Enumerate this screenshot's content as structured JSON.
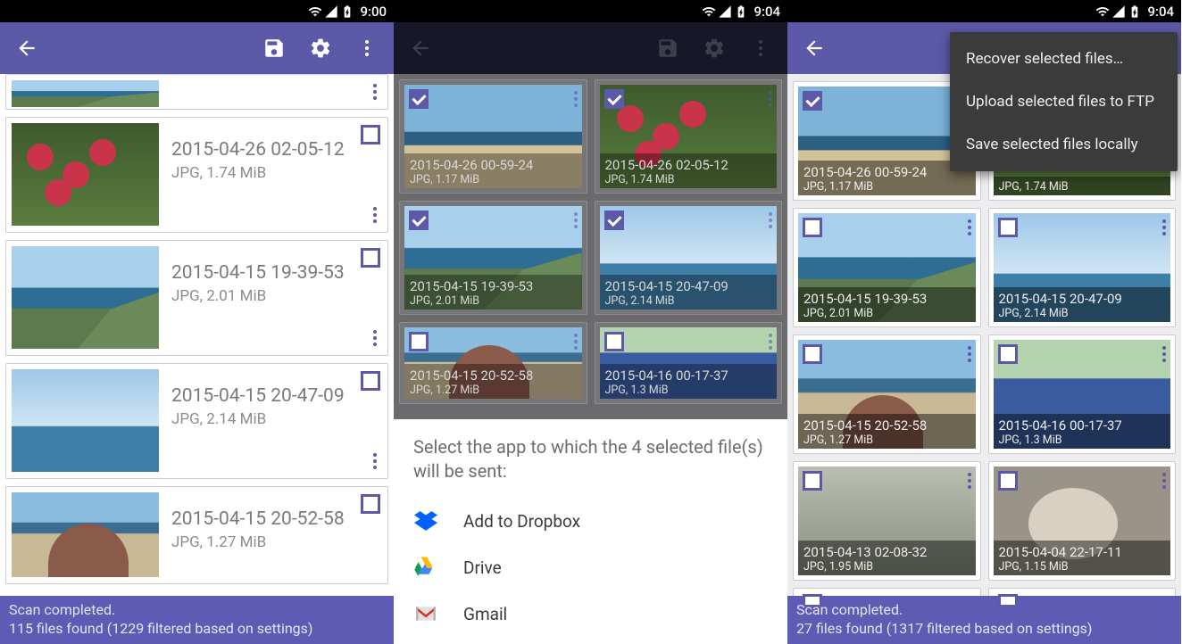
{
  "screen1": {
    "status_time": "9:00",
    "items": [
      {
        "title": "2015-04-26 02-05-12",
        "meta": "JPG, 1.74 MiB"
      },
      {
        "title": "2015-04-15 19-39-53",
        "meta": "JPG, 2.01 MiB"
      },
      {
        "title": "2015-04-15 20-47-09",
        "meta": "JPG, 2.14 MiB"
      },
      {
        "title": "2015-04-15 20-52-58",
        "meta": "JPG, 1.27 MiB"
      }
    ],
    "footer_line1": "Scan completed.",
    "footer_line2": "115 files found (1229 filtered based on settings)"
  },
  "screen2": {
    "status_time": "9:04",
    "items": [
      {
        "title": "2015-04-26 00-59-24",
        "meta": "JPG, 1.17 MiB",
        "checked": true
      },
      {
        "title": "2015-04-26 02-05-12",
        "meta": "JPG, 1.74 MiB",
        "checked": true
      },
      {
        "title": "2015-04-15 19-39-53",
        "meta": "JPG, 2.01 MiB",
        "checked": true
      },
      {
        "title": "2015-04-15 20-47-09",
        "meta": "JPG, 2.14 MiB",
        "checked": true
      },
      {
        "title": "2015-04-15 20-52-58",
        "meta": "JPG, 1.27 MiB",
        "checked": false
      },
      {
        "title": "2015-04-16 00-17-37",
        "meta": "JPG, 1.3 MiB",
        "checked": false
      }
    ],
    "sheet_title": "Select the app to which the 4 selected file(s) will be sent:",
    "apps": {
      "dropbox": "Add to Dropbox",
      "drive": "Drive",
      "gmail": "Gmail"
    }
  },
  "screen3": {
    "status_time": "9:04",
    "menu": {
      "recover": "Recover selected files…",
      "ftp": "Upload selected files to FTP",
      "local": "Save selected files locally"
    },
    "items": [
      {
        "title": "2015-04-26 00-59-24",
        "meta": "JPG, 1.17 MiB",
        "checked": true
      },
      {
        "title": "",
        "meta": "JPG, 1.74 MiB",
        "checked": false
      },
      {
        "title": "2015-04-15 19-39-53",
        "meta": "JPG, 2.01 MiB",
        "checked": false
      },
      {
        "title": "2015-04-15 20-47-09",
        "meta": "JPG, 2.14 MiB",
        "checked": false
      },
      {
        "title": "2015-04-15 20-52-58",
        "meta": "JPG, 1.27 MiB",
        "checked": false
      },
      {
        "title": "2015-04-16 00-17-37",
        "meta": "JPG, 1.3 MiB",
        "checked": false
      },
      {
        "title": "2015-04-13 02-08-32",
        "meta": "JPG, 1.95 MiB",
        "checked": false
      },
      {
        "title": "2015-04-04 22-17-11",
        "meta": "JPG, 1.15 MiB",
        "checked": false
      }
    ],
    "footer_line1": "Scan completed.",
    "footer_line2": "27 files found (1317 filtered based on settings)"
  }
}
